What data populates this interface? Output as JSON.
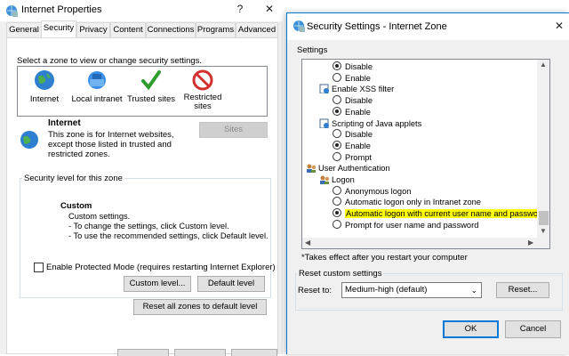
{
  "left_window": {
    "title": "Internet Properties",
    "help_glyph": "?",
    "close_glyph": "✕",
    "tabs": [
      "General",
      "Security",
      "Privacy",
      "Content",
      "Connections",
      "Programs",
      "Advanced"
    ],
    "active_tab": "Security",
    "zone_prompt": "Select a zone to view or change security settings.",
    "zones": [
      {
        "label": "Internet",
        "icon": "globe-icon"
      },
      {
        "label": "Local intranet",
        "icon": "network-icon"
      },
      {
        "label": "Trusted sites",
        "icon": "checkmark-icon"
      },
      {
        "label": "Restricted sites",
        "icon": "no-entry-icon"
      }
    ],
    "zone_title": "Internet",
    "zone_description": "This zone is for Internet websites, except those listed in trusted and restricted zones.",
    "zone_description_lines": [
      "This zone is for Internet websites,",
      "except those listed in trusted and",
      "restricted zones."
    ],
    "sites_button": "Sites",
    "security_level_group": "Security level for this zone",
    "custom_title": "Custom",
    "custom_lines": [
      "Custom settings.",
      "- To change the settings, click Custom level.",
      "- To use the recommended settings, click Default level."
    ],
    "protected_mode_label": "Enable Protected Mode (requires restarting Internet Explorer)",
    "protected_mode_checked": false,
    "custom_level_button": "Custom level...",
    "default_level_button": "Default level",
    "reset_all_button": "Reset all zones to default level"
  },
  "right_window": {
    "title": "Security Settings - Internet Zone",
    "close_glyph": "✕",
    "settings_label": "Settings",
    "tree_rows": [
      {
        "type": "radio",
        "label": "Disable",
        "checked": true,
        "indent": 2
      },
      {
        "type": "radio",
        "label": "Enable",
        "checked": false,
        "indent": 2
      },
      {
        "type": "folder",
        "label": "Enable XSS filter",
        "indent": 1
      },
      {
        "type": "radio",
        "label": "Disable",
        "checked": false,
        "indent": 2
      },
      {
        "type": "radio",
        "label": "Enable",
        "checked": true,
        "indent": 2
      },
      {
        "type": "folder",
        "label": "Scripting of Java applets",
        "indent": 1
      },
      {
        "type": "radio",
        "label": "Disable",
        "checked": false,
        "indent": 2
      },
      {
        "type": "radio",
        "label": "Enable",
        "checked": true,
        "indent": 2
      },
      {
        "type": "radio",
        "label": "Prompt",
        "checked": false,
        "indent": 2
      },
      {
        "type": "users",
        "label": "User Authentication",
        "indent": 0
      },
      {
        "type": "users",
        "label": "Logon",
        "indent": 1
      },
      {
        "type": "radio",
        "label": "Anonymous logon",
        "checked": false,
        "indent": 2
      },
      {
        "type": "radio",
        "label": "Automatic logon only in Intranet zone",
        "checked": false,
        "indent": 2
      },
      {
        "type": "radio",
        "label": "Automatic logon with current user name and password",
        "checked": true,
        "indent": 2,
        "highlight": true
      },
      {
        "type": "radio",
        "label": "Prompt for user name and password",
        "checked": false,
        "indent": 2
      }
    ],
    "highlight_color": "#ffff00",
    "takes_effect_note": "*Takes effect after you restart your computer",
    "reset_group_label": "Reset custom settings",
    "reset_to_label": "Reset to:",
    "reset_to_value": "Medium-high (default)",
    "reset_button": "Reset...",
    "ok_button": "OK",
    "cancel_button": "Cancel"
  }
}
